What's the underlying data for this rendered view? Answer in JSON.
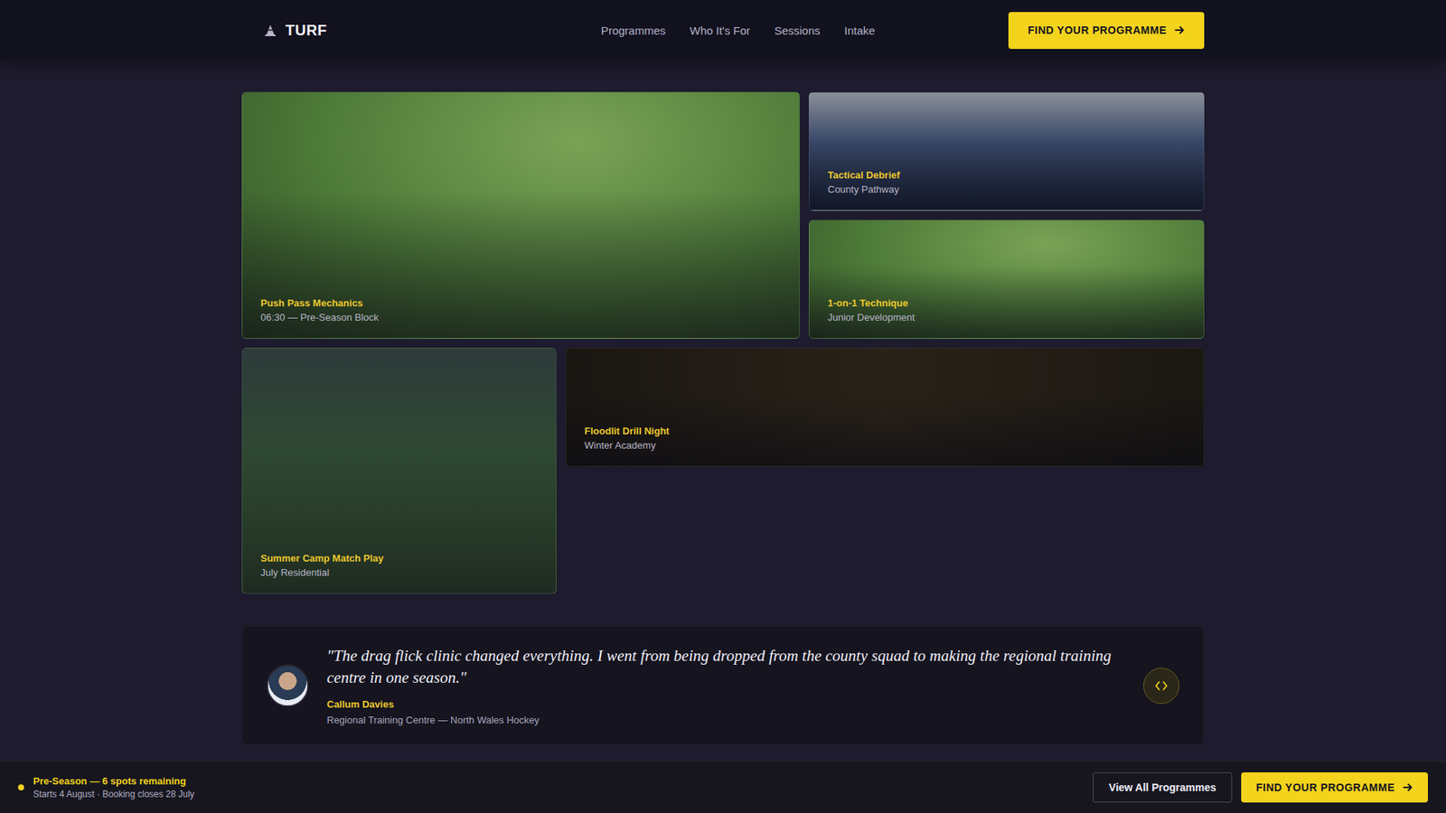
{
  "brand": {
    "name": "TURF"
  },
  "nav": [
    {
      "label": "Programmes"
    },
    {
      "label": "Who It's For"
    },
    {
      "label": "Sessions"
    },
    {
      "label": "Intake"
    }
  ],
  "header_cta": {
    "label": "FIND YOUR PROGRAMME"
  },
  "gallery": [
    {
      "title": "Push Pass Mechanics",
      "subtitle": "06:30 — Pre-Season Block"
    },
    {
      "title": "Tactical Debrief",
      "subtitle": "County Pathway"
    },
    {
      "title": "1-on-1 Technique",
      "subtitle": "Junior Development"
    },
    {
      "title": "Summer Camp Match Play",
      "subtitle": "July Residential"
    },
    {
      "title": "Floodlit Drill Night",
      "subtitle": "Winter Academy"
    }
  ],
  "testimonial": {
    "quote": "\"The drag flick clinic changed everything. I went from being dropped from the county squad to making the regional training centre in one season.\"",
    "name": "Callum Davies",
    "role": "Regional Training Centre — North Wales Hockey"
  },
  "bottom_bar": {
    "title": "Pre-Season — 6 spots remaining",
    "detail": "Starts 4 August · Booking closes 28 July",
    "secondary": "View All Programmes",
    "primary": "FIND YOUR PROGRAMME"
  }
}
